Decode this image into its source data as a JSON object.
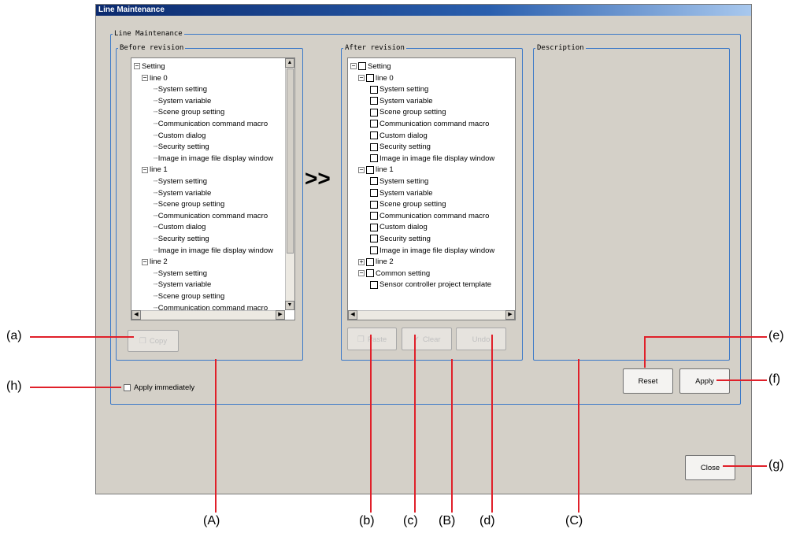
{
  "window": {
    "title": "Line Maintenance"
  },
  "main_group": {
    "title": "Line Maintenance"
  },
  "before": {
    "title": "Before revision",
    "root": "Setting",
    "lines": [
      {
        "label": "line 0",
        "items": [
          "System setting",
          "System variable",
          "Scene group setting",
          "Communication command macro",
          "Custom dialog",
          "Security setting",
          "Image in image file display window"
        ]
      },
      {
        "label": "line 1",
        "items": [
          "System setting",
          "System variable",
          "Scene group setting",
          "Communication command macro",
          "Custom dialog",
          "Security setting",
          "Image in image file display window"
        ]
      },
      {
        "label": "line 2",
        "items": [
          "System setting",
          "System variable",
          "Scene group setting",
          "Communication command macro"
        ]
      }
    ],
    "copy_label": "Copy"
  },
  "arrow": ">>",
  "after": {
    "title": "After revision",
    "root": "Setting",
    "lines": [
      {
        "label": "line 0",
        "expanded": true,
        "items": [
          "System setting",
          "System variable",
          "Scene group setting",
          "Communication command macro",
          "Custom dialog",
          "Security setting",
          "Image in image file display window"
        ]
      },
      {
        "label": "line 1",
        "expanded": true,
        "items": [
          "System setting",
          "System variable",
          "Scene group setting",
          "Communication command macro",
          "Custom dialog",
          "Security setting",
          "Image in image file display window"
        ]
      },
      {
        "label": "line 2",
        "expanded": false,
        "items": []
      },
      {
        "label": "Common setting",
        "expanded": true,
        "items": [
          "Sensor controller project template"
        ]
      }
    ],
    "paste_label": "Paste",
    "clear_label": "Clear",
    "undo_label": "Undo"
  },
  "description": {
    "title": "Description"
  },
  "apply_immediately_label": "Apply immediately",
  "reset_label": "Reset",
  "apply_label": "Apply",
  "close_label": "Close",
  "annotations": {
    "a": "(a)",
    "b": "(b)",
    "c": "(c)",
    "d": "(d)",
    "e": "(e)",
    "f": "(f)",
    "g": "(g)",
    "h": "(h)",
    "A": "(A)",
    "B": "(B)",
    "C": "(C)"
  },
  "colors": {
    "annotation_line": "#e0202a",
    "group_border": "#3a78c8"
  }
}
